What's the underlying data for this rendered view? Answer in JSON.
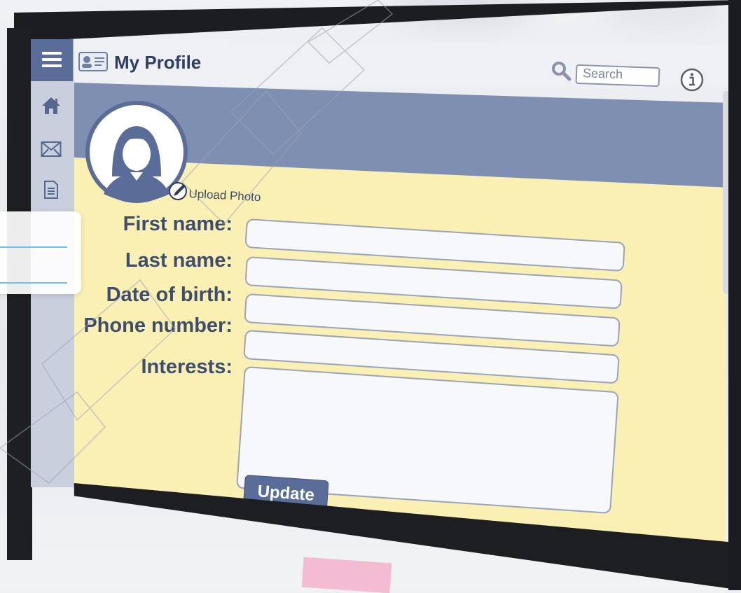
{
  "header": {
    "title": "My Profile",
    "search_placeholder": "Search",
    "icons": {
      "menu": "hamburger-icon",
      "profile_card": "id-card-icon",
      "search": "magnifier-icon",
      "info": "info-icon"
    }
  },
  "sidebar": {
    "items": [
      {
        "icon": "home-icon"
      },
      {
        "icon": "envelope-icon"
      },
      {
        "icon": "document-icon"
      }
    ]
  },
  "profile": {
    "upload_label": "Upload Photo"
  },
  "form": {
    "first_name_label": "First name:",
    "last_name_label": "Last name:",
    "dob_label": "Date of birth:",
    "phone_label": "Phone number:",
    "interests_label": "Interests:",
    "update_label": "Update"
  },
  "colors": {
    "accent": "#5a6d99",
    "banner": "#7f8fb2",
    "panel": "#fbf0b4",
    "sidebar": "#c9cfdc"
  }
}
